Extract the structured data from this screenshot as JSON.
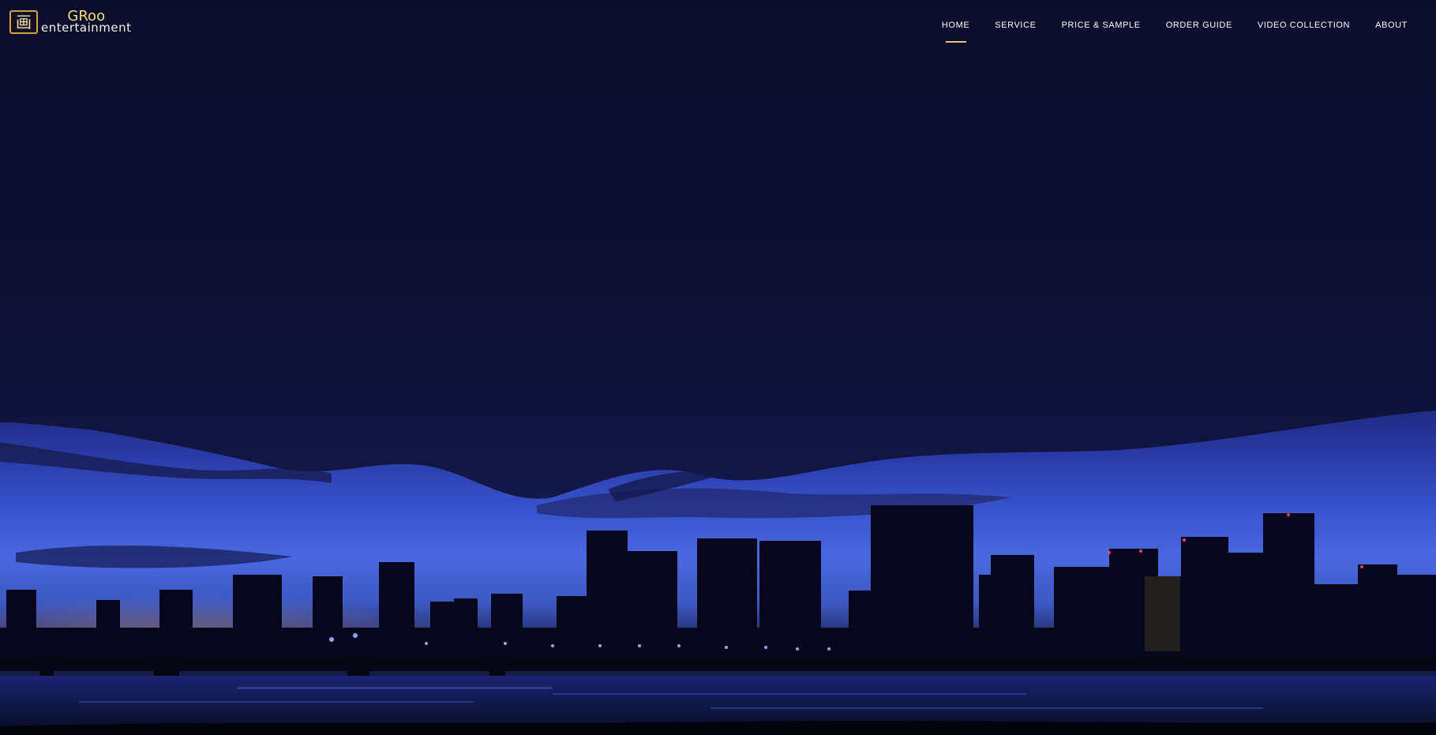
{
  "brand": {
    "logo_mark": "画",
    "logo_top": "GRoo",
    "logo_bottom": "entertainment"
  },
  "nav": {
    "items": [
      {
        "label": "HOME",
        "active": true
      },
      {
        "label": "SERVICE",
        "active": false
      },
      {
        "label": "PRICE & SAMPLE",
        "active": false
      },
      {
        "label": "ORDER GUIDE",
        "active": false
      },
      {
        "label": "VIDEO COLLECTION",
        "active": false
      },
      {
        "label": "ABOUT",
        "active": false
      }
    ]
  },
  "colors": {
    "accent": "#e6c86a",
    "logo_gold": "#f3de7c",
    "nav_text": "#ffffff"
  }
}
